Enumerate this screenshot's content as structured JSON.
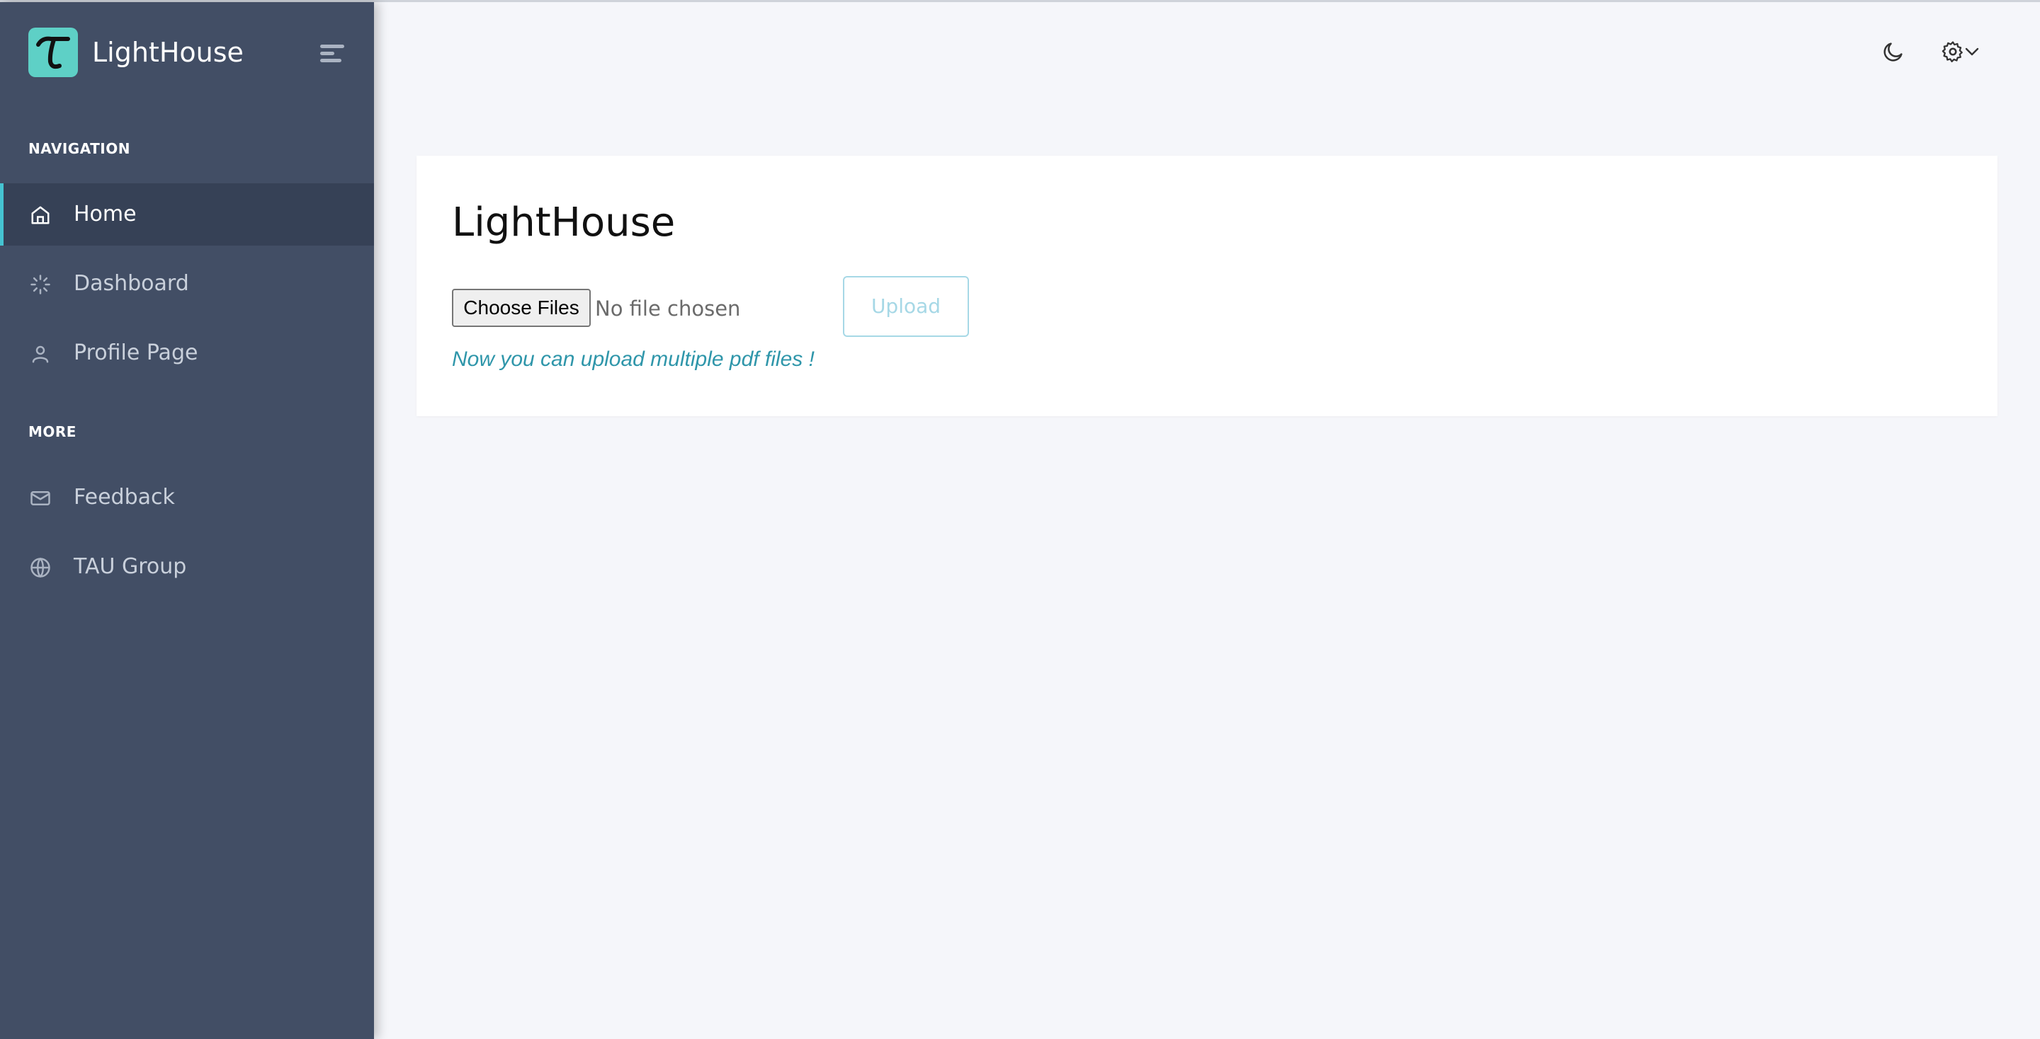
{
  "app": {
    "name": "LightHouse",
    "logo_glyph": "τ",
    "accent": "#45c3d1"
  },
  "sidebar": {
    "sections": [
      {
        "label": "NAVIGATION"
      },
      {
        "label": "MORE"
      }
    ],
    "items": [
      {
        "label": "Home",
        "icon": "home-icon",
        "active": true
      },
      {
        "label": "Dashboard",
        "icon": "loader-icon",
        "active": false
      },
      {
        "label": "Profile Page",
        "icon": "user-icon",
        "active": false
      },
      {
        "label": "Feedback",
        "icon": "mail-icon",
        "active": false
      },
      {
        "label": "TAU Group",
        "icon": "globe-icon",
        "active": false
      }
    ]
  },
  "header": {
    "actions": [
      {
        "icon": "moon-icon"
      },
      {
        "icon": "gear-icon"
      }
    ]
  },
  "main": {
    "title": "LightHouse",
    "file_input": {
      "button_label": "Choose Files",
      "status": "No file chosen"
    },
    "upload_label": "Upload",
    "hint": "Now you can upload multiple pdf files !"
  }
}
